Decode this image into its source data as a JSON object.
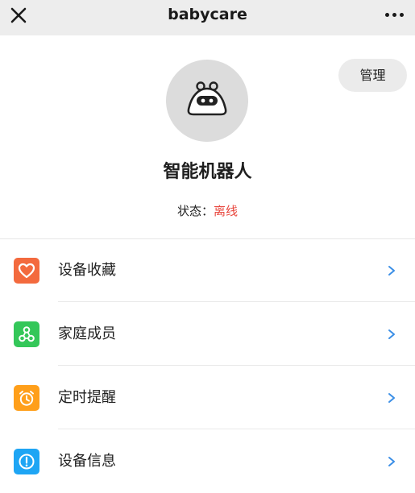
{
  "topbar": {
    "title": "babycare",
    "close_icon": "close-icon",
    "more_icon": "more-icon"
  },
  "header": {
    "manage_label": "管理",
    "avatar_icon": "robot-icon",
    "device_name": "智能机器人",
    "status_label": "状态：",
    "status_value": "离线",
    "status_color": "#e8473e"
  },
  "menu": [
    {
      "label": "设备收藏",
      "icon": "heart-icon",
      "color": "#f36a3e"
    },
    {
      "label": "家庭成员",
      "icon": "members-icon",
      "color": "#34c759"
    },
    {
      "label": "定时提醒",
      "icon": "alarm-icon",
      "color": "#ff9f1a"
    },
    {
      "label": "设备信息",
      "icon": "info-icon",
      "color": "#1ea5f4"
    }
  ],
  "chevron_color": "#3a8ee6"
}
